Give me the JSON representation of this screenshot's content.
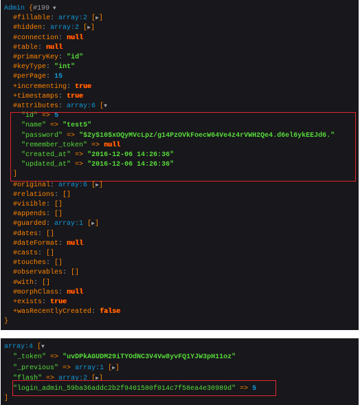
{
  "model": {
    "class_name": "Admin",
    "object_id": "#199",
    "properties": [
      {
        "prefix": "#",
        "key": "fillable",
        "type": "array",
        "value": "array:2",
        "collapsed": true
      },
      {
        "prefix": "#",
        "key": "hidden",
        "type": "array",
        "value": "array:2",
        "collapsed": true
      },
      {
        "prefix": "#",
        "key": "connection",
        "type": "const",
        "value": "null"
      },
      {
        "prefix": "#",
        "key": "table",
        "type": "const",
        "value": "null"
      },
      {
        "prefix": "#",
        "key": "primaryKey",
        "type": "str",
        "value": "id"
      },
      {
        "prefix": "#",
        "key": "keyType",
        "type": "str",
        "value": "int"
      },
      {
        "prefix": "#",
        "key": "perPage",
        "type": "num",
        "value": "15"
      },
      {
        "prefix": "+",
        "key": "incrementing",
        "type": "const",
        "value": "true"
      },
      {
        "prefix": "+",
        "key": "timestamps",
        "type": "const",
        "value": "true"
      },
      {
        "prefix": "#",
        "key": "attributes",
        "type": "array",
        "value": "array:6",
        "collapsed": false
      }
    ],
    "attributes": [
      {
        "key": "id",
        "type": "num",
        "value": "5"
      },
      {
        "key": "name",
        "type": "str",
        "value": "test5"
      },
      {
        "key": "password",
        "type": "str",
        "value": "$2y$10$xOQyMVcLpz/g14PzOVkFoecW64Ve4z4rVWH2Qe4.d6el6ykEEJd6."
      },
      {
        "key": "remember_token",
        "type": "const",
        "value": "null"
      },
      {
        "key": "created_at",
        "type": "str",
        "value": "2016-12-06 14:26:36"
      },
      {
        "key": "updated_at",
        "type": "str",
        "value": "2016-12-06 14:26:36"
      }
    ],
    "properties_after": [
      {
        "prefix": "#",
        "key": "original",
        "type": "array",
        "value": "array:6",
        "collapsed": true
      },
      {
        "prefix": "#",
        "key": "relations",
        "type": "empty",
        "value": "[]"
      },
      {
        "prefix": "#",
        "key": "visible",
        "type": "empty",
        "value": "[]"
      },
      {
        "prefix": "#",
        "key": "appends",
        "type": "empty",
        "value": "[]"
      },
      {
        "prefix": "#",
        "key": "guarded",
        "type": "array",
        "value": "array:1",
        "collapsed": true
      },
      {
        "prefix": "#",
        "key": "dates",
        "type": "empty",
        "value": "[]"
      },
      {
        "prefix": "#",
        "key": "dateFormat",
        "type": "const",
        "value": "null"
      },
      {
        "prefix": "#",
        "key": "casts",
        "type": "empty",
        "value": "[]"
      },
      {
        "prefix": "#",
        "key": "touches",
        "type": "empty",
        "value": "[]"
      },
      {
        "prefix": "#",
        "key": "observables",
        "type": "empty",
        "value": "[]"
      },
      {
        "prefix": "#",
        "key": "with",
        "type": "empty",
        "value": "[]"
      },
      {
        "prefix": "#",
        "key": "morphClass",
        "type": "const",
        "value": "null"
      },
      {
        "prefix": "+",
        "key": "exists",
        "type": "const",
        "value": "true"
      },
      {
        "prefix": "+",
        "key": "wasRecentlyCreated",
        "type": "const",
        "value": "false"
      }
    ]
  },
  "session": {
    "header": "array:4",
    "items": [
      {
        "key": "_token",
        "type": "str",
        "value": "uvDPkAGUDM29iTYOdNC3V4Vw8yvFQ1YJW3pH11oz"
      },
      {
        "key": "_previous",
        "type": "array",
        "value": "array:1",
        "collapsed": true
      },
      {
        "key": "flash",
        "type": "array",
        "value": "array:2",
        "collapsed": true
      },
      {
        "key": "login_admin_59ba36addc2b2f9401580f014c7f58ea4e30989d",
        "type": "num",
        "value": "5"
      }
    ]
  },
  "colors": {
    "background": "#18171B",
    "key": "#FF8400",
    "string": "#56DB3A",
    "number": "#1299DA",
    "highlight_box": "#E0282E"
  }
}
